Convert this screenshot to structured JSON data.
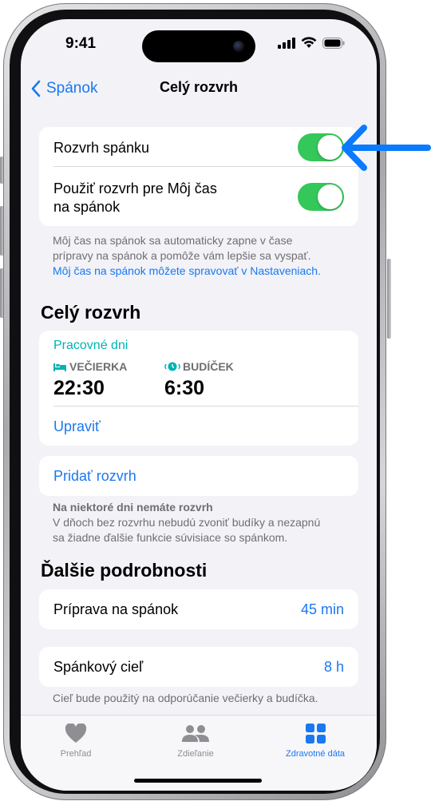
{
  "status": {
    "time": "9:41"
  },
  "nav": {
    "back_label": "Spánok",
    "title": "Celý rozvrh"
  },
  "settings": {
    "schedule_label": "Rozvrh spánku",
    "use_schedule_line1": "Použiť rozvrh pre Môj čas",
    "use_schedule_line2": "na spánok"
  },
  "info": {
    "line1": "Môj čas na spánok sa automaticky zapne v čase",
    "line2": "prípravy na spánok a pomôže vám lepšie sa vyspať.",
    "link": "Môj čas na spánok môžete spravovať v Nastaveniach."
  },
  "full_schedule": {
    "title": "Celý rozvrh",
    "days": "Pracovné dni",
    "bedtime_label": "VEČIERKA",
    "bedtime_value": "22:30",
    "wake_label": "BUDÍČEK",
    "wake_value": "6:30",
    "edit": "Upraviť",
    "add": "Pridať rozvrh",
    "note_title": "Na niektoré dni nemáte rozvrh",
    "note_line1": "V dňoch bez rozvrhu nebudú zvoniť budíky a nezapnú",
    "note_line2": "sa žiadne ďalšie funkcie súvisiace so spánkom."
  },
  "details": {
    "title": "Ďalšie podrobnosti",
    "prep_label": "Príprava na spánok",
    "prep_value": "45 min",
    "goal_label": "Spánkový cieľ",
    "goal_value": "8 h",
    "goal_note": "Cieľ bude použitý na odporúčanie večierky a budíčka."
  },
  "tabs": [
    {
      "label": "Prehľad",
      "icon": "heart-icon"
    },
    {
      "label": "Zdieľanie",
      "icon": "people-icon"
    },
    {
      "label": "Zdravotné dáta",
      "icon": "grid-icon"
    }
  ],
  "colors": {
    "accent": "#1a78f0",
    "toggle_on": "#34c759",
    "teal": "#00b3b3",
    "callout_arrow": "#0a7aff"
  }
}
